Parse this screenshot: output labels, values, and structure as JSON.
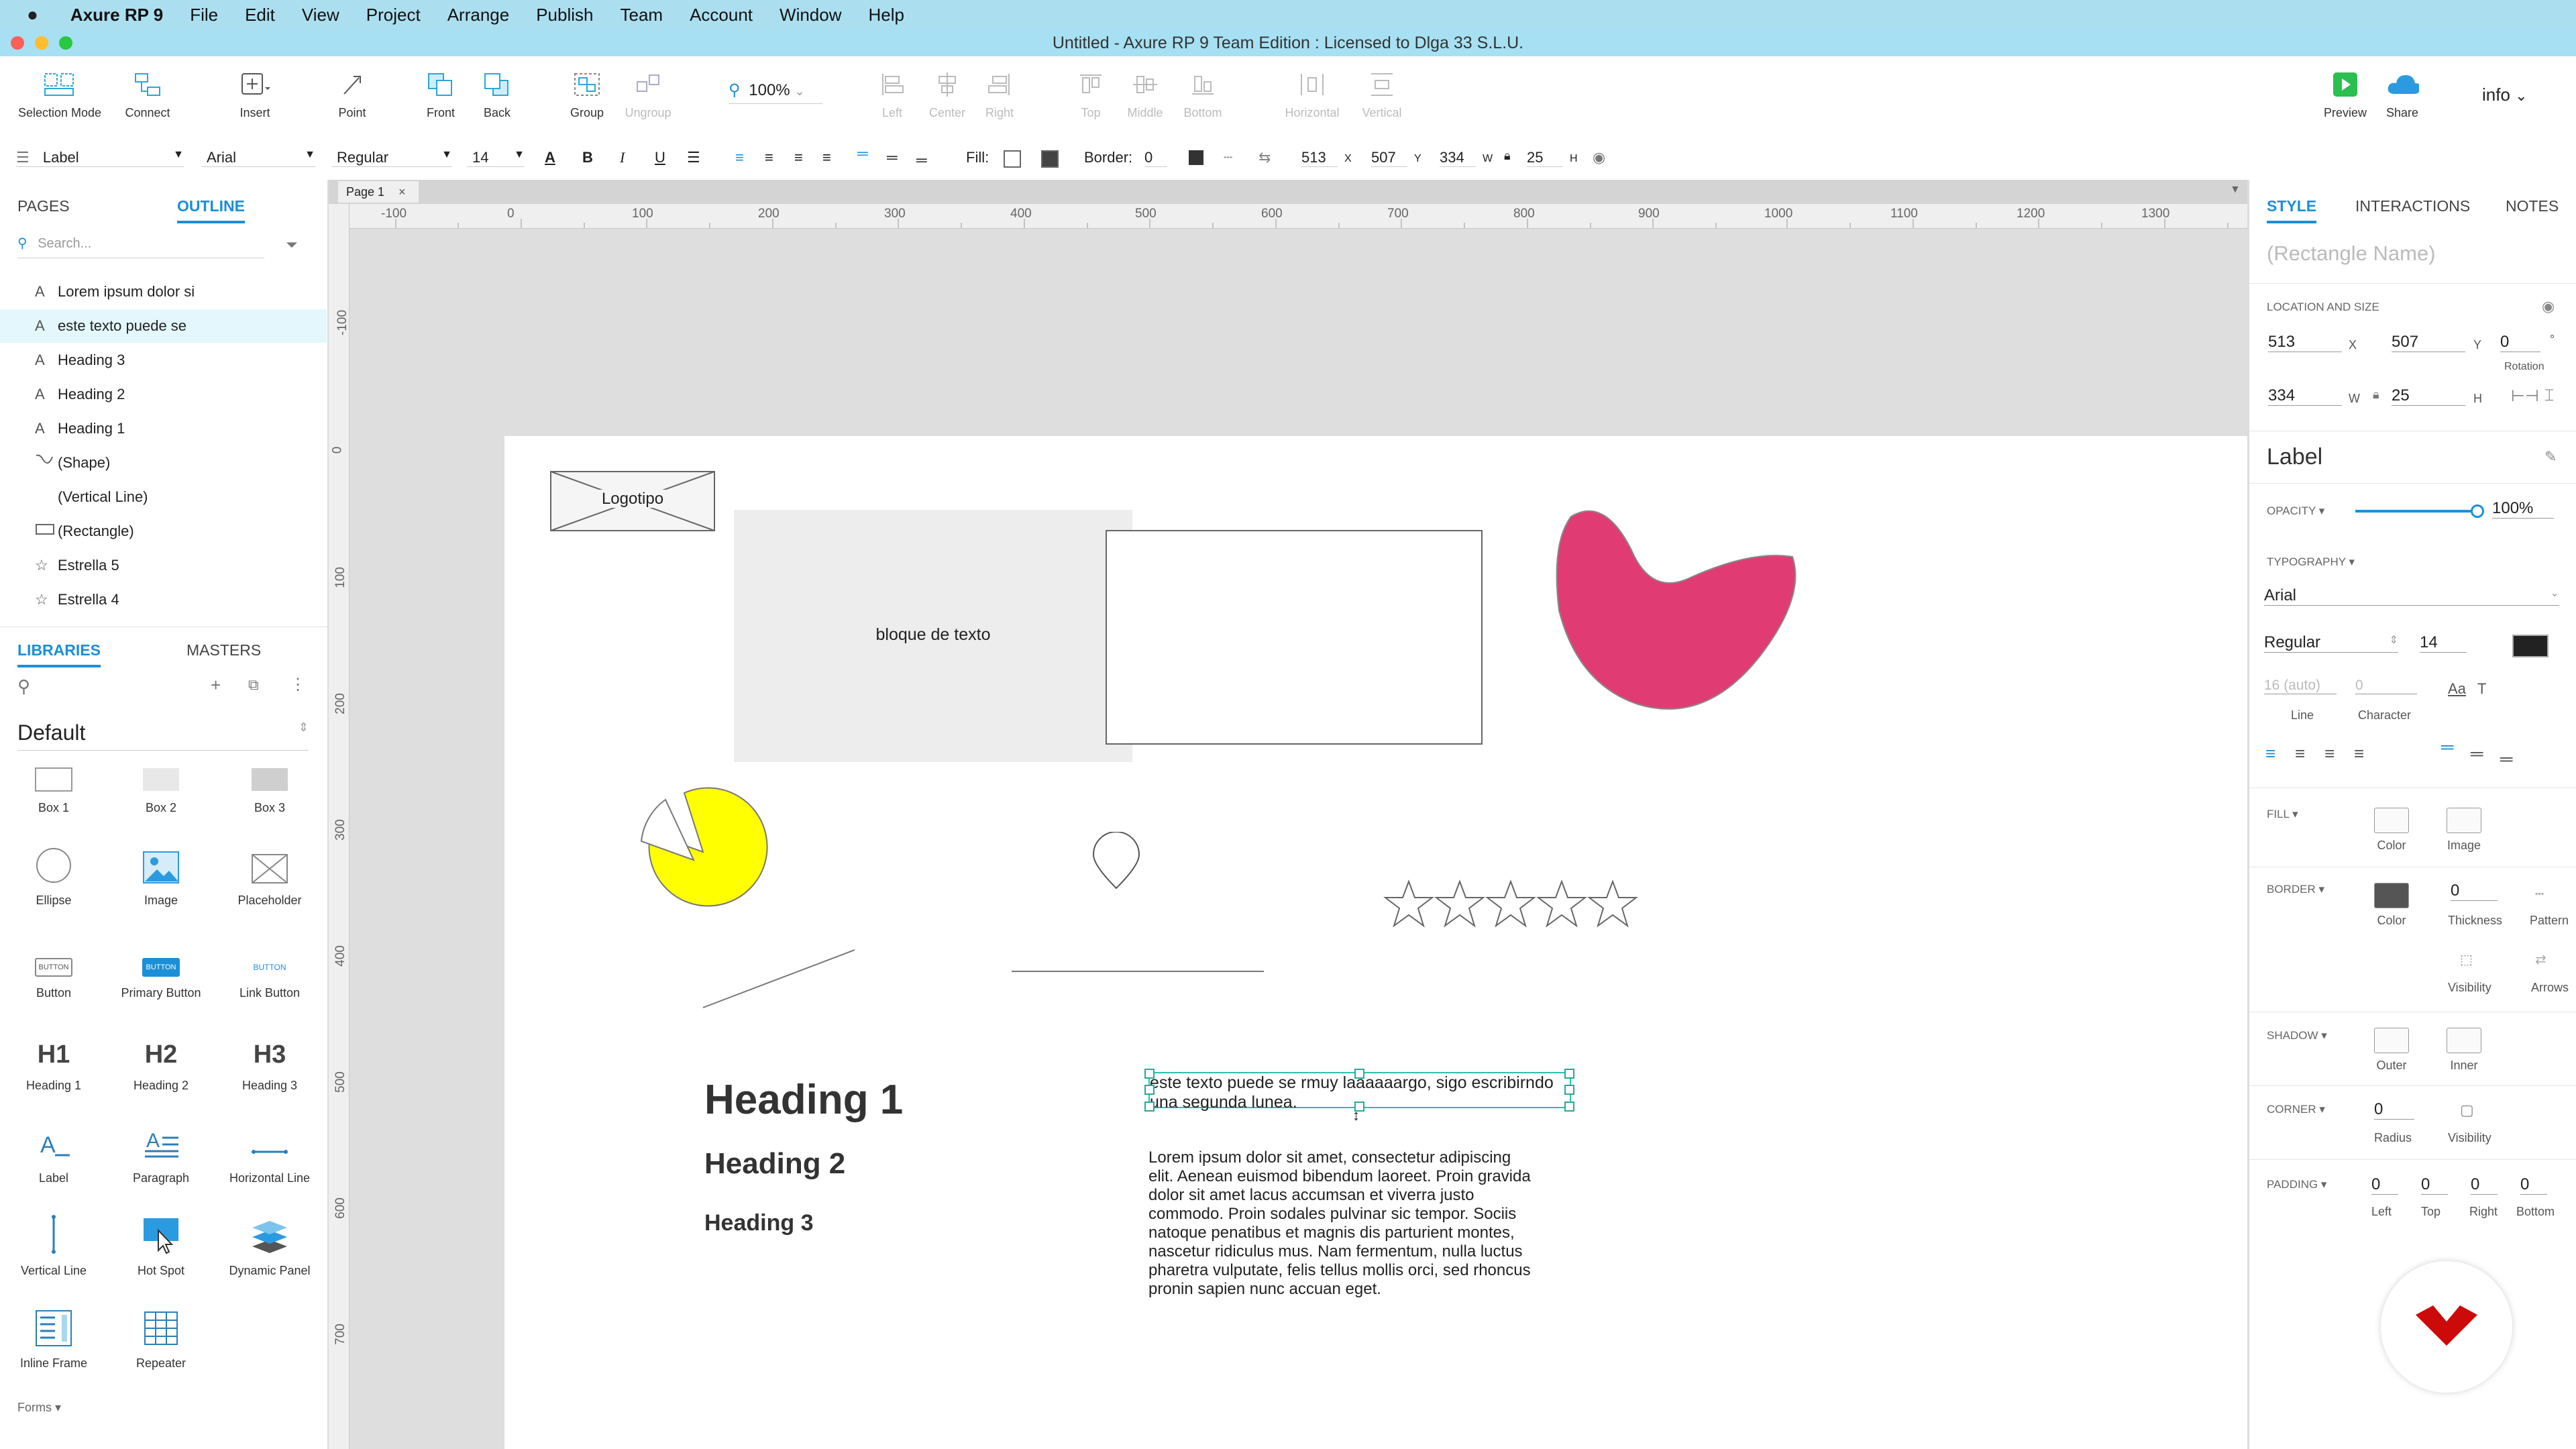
{
  "menubar": {
    "app": "Axure RP 9",
    "items": [
      "File",
      "Edit",
      "View",
      "Project",
      "Arrange",
      "Publish",
      "Team",
      "Account",
      "Window",
      "Help"
    ]
  },
  "window_title": "Untitled - Axure RP 9 Team Edition : Licensed to Dlga 33 S.L.U.",
  "toolbar": {
    "selection_mode": "Selection Mode",
    "connect": "Connect",
    "insert": "Insert",
    "point": "Point",
    "front": "Front",
    "back": "Back",
    "group": "Group",
    "ungroup": "Ungroup",
    "zoom": "100%",
    "left": "Left",
    "center": "Center",
    "right": "Right",
    "top": "Top",
    "middle": "Middle",
    "bottom": "Bottom",
    "horizontal": "Horizontal",
    "vertical": "Vertical",
    "preview": "Preview",
    "share": "Share",
    "account": "info"
  },
  "format": {
    "style": "Label",
    "font": "Arial",
    "weight": "Regular",
    "size": "14",
    "fill_label": "Fill:",
    "border_label": "Border:",
    "border_value": "0",
    "x": "513",
    "x_label": "X",
    "y": "507",
    "y_label": "Y",
    "w": "334",
    "w_label": "W",
    "h": "25",
    "h_label": "H"
  },
  "left": {
    "tab_pages": "PAGES",
    "tab_outline": "OUTLINE",
    "search_placeholder": "Search...",
    "outline": [
      {
        "glyph": "A",
        "label": "Lorem ipsum dolor si"
      },
      {
        "glyph": "A",
        "label": "este texto puede se"
      },
      {
        "glyph": "A",
        "label": "Heading 3"
      },
      {
        "glyph": "A",
        "label": "Heading 2"
      },
      {
        "glyph": "A",
        "label": "Heading 1"
      },
      {
        "glyph": "",
        "label": "(Shape)"
      },
      {
        "glyph": "",
        "label": "(Vertical Line)"
      },
      {
        "glyph": "",
        "label": "(Rectangle)"
      },
      {
        "glyph": "☆",
        "label": "Estrella 5"
      },
      {
        "glyph": "☆",
        "label": "Estrella 4"
      }
    ],
    "tab_libraries": "LIBRARIES",
    "tab_masters": "MASTERS",
    "library_name": "Default",
    "widgets": [
      "Box 1",
      "Box 2",
      "Box 3",
      "Ellipse",
      "Image",
      "Placeholder",
      "Button",
      "Primary Button",
      "Link Button",
      "Heading 1",
      "Heading 2",
      "Heading 3",
      "Label",
      "Paragraph",
      "Horizontal Line",
      "Vertical Line",
      "Hot Spot",
      "Dynamic Panel",
      "Inline Frame",
      "Repeater"
    ],
    "widget_text": {
      "button": "BUTTON",
      "h1": "H1",
      "h2": "H2",
      "h3": "H3"
    },
    "forms": "Forms ▾"
  },
  "canvas": {
    "page_tab": "Page 1",
    "hruler": [
      "-100",
      "0",
      "100",
      "200",
      "300",
      "400",
      "500",
      "600",
      "700",
      "800",
      "900",
      "1000",
      "1100",
      "1200",
      "1300"
    ],
    "vruler": [
      "-100",
      "0",
      "100",
      "200",
      "300",
      "400",
      "500",
      "600",
      "700"
    ],
    "logo": "Logotipo",
    "text_block": "bloque de texto",
    "heading1": "Heading 1",
    "heading2": "Heading 2",
    "heading3": "Heading 3",
    "selected_text": "este texto puede se rmuy laaaaaargo, sigo escribirndo una segunda lunea.",
    "paragraph": "Lorem ipsum dolor sit amet, consectetur adipiscing elit. Aenean euismod bibendum laoreet. Proin gravida dolor sit amet lacus accumsan et viverra justo commodo. Proin sodales pulvinar sic tempor. Sociis natoque penatibus et magnis dis parturient montes, nascetur ridiculus mus. Nam fermentum, nulla luctus pharetra vulputate, felis tellus mollis orci, sed rhoncus pronin sapien nunc accuan eget."
  },
  "right": {
    "tab_style": "STYLE",
    "tab_interactions": "INTERACTIONS",
    "tab_notes": "NOTES",
    "name_placeholder": "(Rectangle Name)",
    "location_title": "LOCATION AND SIZE",
    "x": "513",
    "y": "507",
    "rotation": "0",
    "w": "334",
    "h": "25",
    "x_l": "X",
    "y_l": "Y",
    "w_l": "W",
    "h_l": "H",
    "rotation_l": "Rotation",
    "deg": "°",
    "style_name": "Label",
    "opacity_title": "OPACITY ▾",
    "opacity": "100%",
    "typography_title": "TYPOGRAPHY ▾",
    "font": "Arial",
    "weight": "Regular",
    "size": "14",
    "text_color": "#222222",
    "line_value": "16 (auto)",
    "line_l": "Line",
    "char_value": "0",
    "char_l": "Character",
    "fill_title": "FILL ▾",
    "fill_color": "Color",
    "fill_image": "Image",
    "border_title": "BORDER ▾",
    "border_color_l": "Color",
    "thickness": "0",
    "thickness_l": "Thickness",
    "pattern_l": "Pattern",
    "visibility_l": "Visibility",
    "arrows_l": "Arrows",
    "shadow_title": "SHADOW ▾",
    "outer_l": "Outer",
    "inner_l": "Inner",
    "corner_title": "CORNER ▾",
    "radius": "0",
    "radius_l": "Radius",
    "corner_vis_l": "Visibility",
    "padding_title": "PADDING ▾",
    "pad_left": "0",
    "pad_top": "0",
    "pad_right": "0",
    "pad_bottom": "0",
    "pad_left_l": "Left",
    "pad_top_l": "Top",
    "pad_right_l": "Right",
    "pad_bottom_l": "Bottom"
  },
  "colors": {
    "accent": "#1b8fd8",
    "blob": "#e03c73",
    "pie": "#ffff00",
    "preview": "#2bbf4f",
    "share": "#2a9be0",
    "logo_badge": "#cc0a0a",
    "selection": "#2dbfae"
  }
}
